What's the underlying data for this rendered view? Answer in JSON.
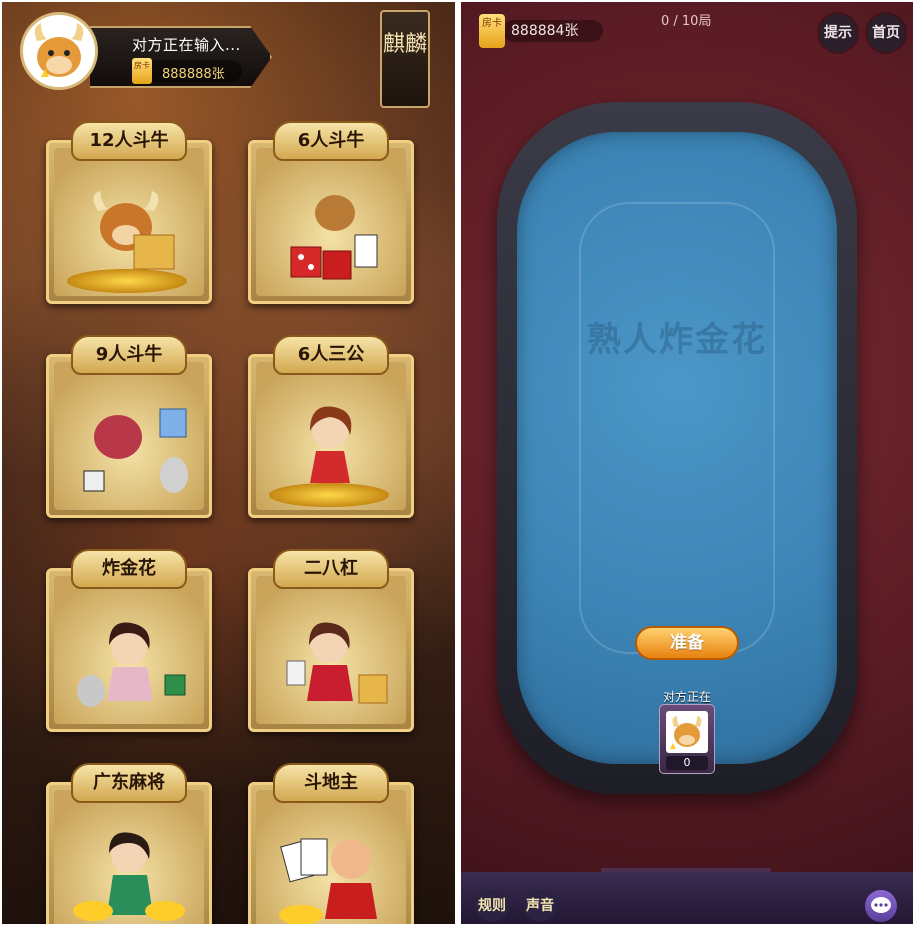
{
  "left": {
    "profile": {
      "name_status": "对方正在输入...",
      "room_card_label": "房卡",
      "room_card_count": "888888张"
    },
    "badge": "麒麟",
    "games": [
      {
        "title": "12人斗牛"
      },
      {
        "title": "6人斗牛"
      },
      {
        "title": "9人斗牛"
      },
      {
        "title": "6人三公"
      },
      {
        "title": "炸金花"
      },
      {
        "title": "二八杠"
      },
      {
        "title": "广东麻将"
      },
      {
        "title": "斗地主"
      }
    ]
  },
  "right": {
    "room_card_label": "房卡",
    "room_card_count": "888884张",
    "round_counter": "0 / 10局",
    "hint_button": "提示",
    "home_button": "首页",
    "table_watermark": "熟人炸金花",
    "ready_button": "准备",
    "seat": {
      "name": "对方正在",
      "score": "0"
    },
    "bottom": {
      "rules_button": "规则",
      "sound_button": "声音"
    }
  }
}
